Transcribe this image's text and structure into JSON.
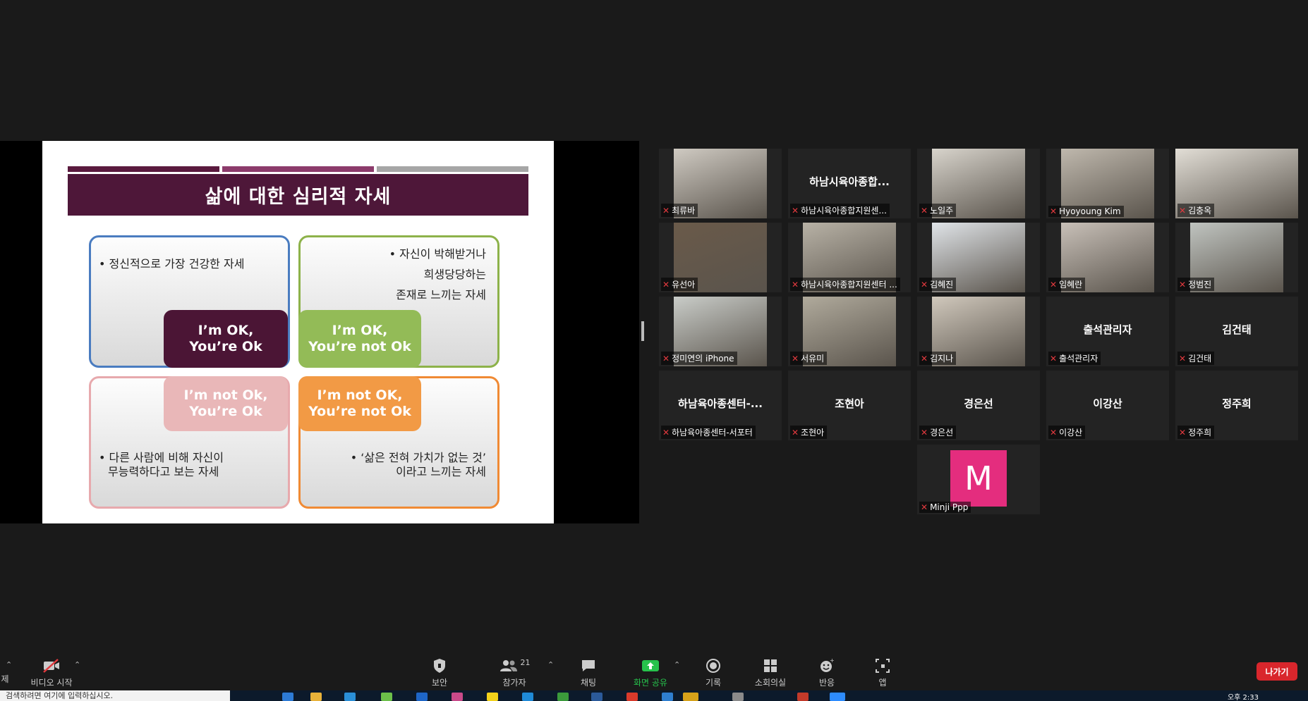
{
  "slide": {
    "title": "삶에 대한 심리적 자세",
    "q1_text": "• 정신적으로 가장 건강한 자세",
    "q1_box": [
      "I’m OK,",
      "You’re Ok"
    ],
    "q2_text": [
      "• 자신이 박해받거나",
      "희생당당하는",
      "존재로 느끼는 자세"
    ],
    "q2_box": [
      "I’m OK,",
      "You’re not Ok"
    ],
    "q3_box": [
      "I’m not Ok,",
      "You’re Ok"
    ],
    "q3_text": [
      "• 다른 사람에 비해 자신이",
      "무능력하다고 보는 자세"
    ],
    "q4_box": [
      "I’m not OK,",
      "You’re not Ok"
    ],
    "q4_text": [
      "• ‘삶은 전혀 가치가 없는 것’",
      "이라고 느끼는 자세"
    ],
    "colors": {
      "title_bg": "#4e1739",
      "bar1": "#5a1a3e",
      "bar2": "#8c3b6b",
      "bar3": "#a6a6a6",
      "q1_border": "#4a7cc0",
      "q2_border": "#8db24a",
      "q3_border": "#e7a9ad",
      "q4_border": "#f08a34"
    }
  },
  "participants": [
    {
      "label": "최류바",
      "display": "",
      "video": true,
      "active": false
    },
    {
      "label": "하남시육아종합지원센...",
      "display": "하남시육아종합...",
      "video": false,
      "active": false
    },
    {
      "label": "노일주",
      "display": "",
      "video": true,
      "active": false
    },
    {
      "label": "Hyoyoung Kim",
      "display": "",
      "video": true,
      "active": false
    },
    {
      "label": "김충옥",
      "display": "",
      "video": true,
      "active": true
    },
    {
      "label": "유선아",
      "display": "",
      "video": true,
      "active": false
    },
    {
      "label": "하남시육아종합지원센터 ...",
      "display": "",
      "video": true,
      "active": false
    },
    {
      "label": "김혜진",
      "display": "",
      "video": true,
      "active": false
    },
    {
      "label": "임혜란",
      "display": "",
      "video": true,
      "active": false
    },
    {
      "label": "정범진",
      "display": "",
      "video": true,
      "active": false
    },
    {
      "label": "정미연의 iPhone",
      "display": "",
      "video": true,
      "active": false
    },
    {
      "label": "서유미",
      "display": "",
      "video": true,
      "active": false
    },
    {
      "label": "김지나",
      "display": "",
      "video": true,
      "active": false
    },
    {
      "label": "출석관리자",
      "display": "출석관리자",
      "video": false,
      "active": false
    },
    {
      "label": "김건태",
      "display": "김건태",
      "video": false,
      "active": false
    },
    {
      "label": "하남육아종센터-서포터",
      "display": "하남육아종센터-...",
      "video": false,
      "active": false
    },
    {
      "label": "조현아",
      "display": "조현아",
      "video": false,
      "active": false
    },
    {
      "label": "경은선",
      "display": "경은선",
      "video": false,
      "active": false
    },
    {
      "label": "이강산",
      "display": "이강산",
      "video": false,
      "active": false
    },
    {
      "label": "정주희",
      "display": "정주희",
      "video": false,
      "active": false
    },
    {
      "label": "Minji Ppp",
      "display": "",
      "avatar_letter": "M",
      "video": false,
      "active": false
    }
  ],
  "toolbar": {
    "audio_label": "제",
    "video_label": "비디오 시작",
    "security_label": "보안",
    "participants_label": "참가자",
    "participants_count": "21",
    "chat_label": "채팅",
    "share_label": "화면 공유",
    "record_label": "기록",
    "breakout_label": "소회의실",
    "reactions_label": "반응",
    "apps_label": "앱",
    "leave_label": "나가기",
    "share_color": "#27c24c",
    "leave_color": "#d9262c"
  },
  "taskbar": {
    "search_placeholder": "검색하려면 여기에 입력하십시오.",
    "clock": "오후 2:33"
  }
}
